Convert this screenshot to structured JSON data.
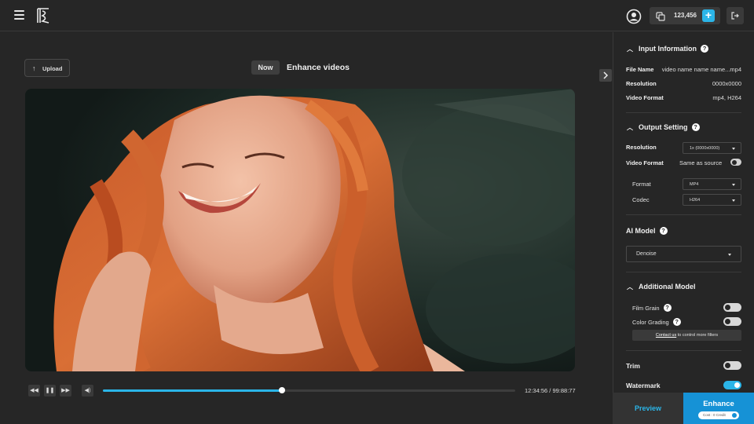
{
  "header": {
    "credits": "123,456",
    "add_credit": "+"
  },
  "main": {
    "upload_label": "Upload",
    "upload_icon": "↑",
    "now_badge": "Now",
    "title": "Enhance videos"
  },
  "player": {
    "rewind": "◀◀",
    "pause": "❚❚",
    "forward": "▶▶",
    "volume": "◀)",
    "progress": 0.435,
    "time": "12:34:56 / 99:88:77"
  },
  "panel": {
    "input_info": {
      "title": "Input Information",
      "file_name_label": "File Name",
      "file_name": "video name name name...mp4",
      "resolution_label": "Resolution",
      "resolution": "0000x0000",
      "format_label": "Video Format",
      "format": "mp4, H264"
    },
    "output": {
      "title": "Output Setting",
      "resolution_label": "Resolution",
      "resolution_value": "1x (0000x0000)",
      "format_label": "Video Format",
      "same_as_source": "Same as source",
      "same_as_source_on": false,
      "sub_format_label": "Format",
      "sub_format_value": "MP4",
      "codec_label": "Codec",
      "codec_value": "H264"
    },
    "ai_model": {
      "title": "AI Model",
      "value": "Denoise"
    },
    "additional": {
      "title": "Additional Model",
      "film_grain": "Film Grain",
      "film_grain_on": false,
      "color_grading": "Color Grading",
      "color_grading_on": false,
      "contact_link": "Contact us",
      "contact_rest": " to control more filters"
    },
    "trim": {
      "label": "Trim",
      "on": false
    },
    "watermark": {
      "label": "Watermark",
      "on": true
    }
  },
  "actions": {
    "preview": "Preview",
    "enhance": "Enhance",
    "cost": "Cost : 0 Credit"
  },
  "colors": {
    "accent": "#2bb5e8",
    "enhance_bg": "#1692d6",
    "bg": "#262626"
  }
}
